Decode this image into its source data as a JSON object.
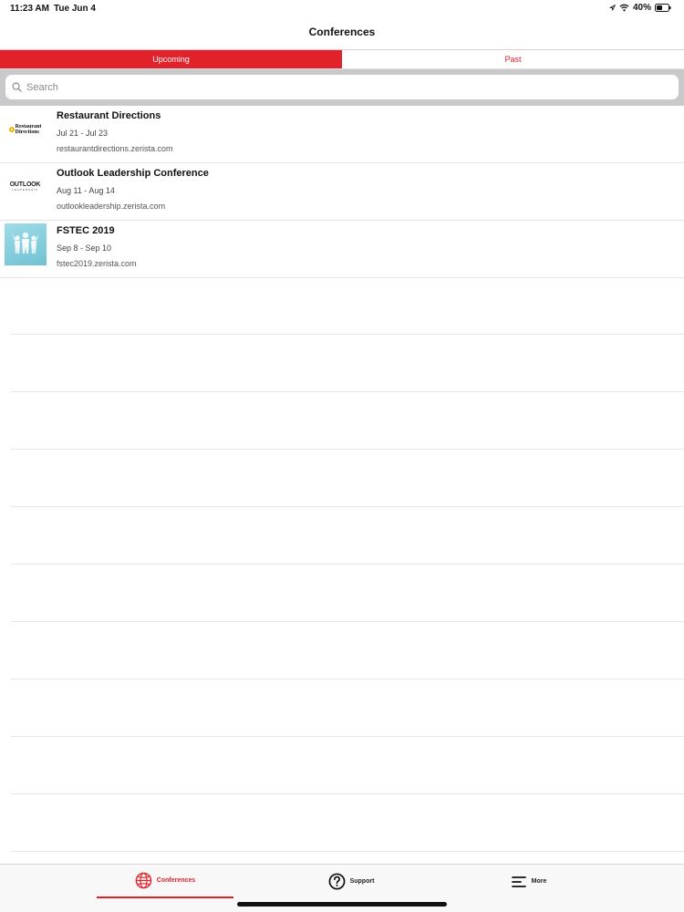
{
  "status_bar": {
    "time": "11:23 AM",
    "date": "Tue Jun 4",
    "battery": "40%"
  },
  "header": {
    "title": "Conferences"
  },
  "segments": {
    "upcoming": "Upcoming",
    "past": "Past",
    "selected": "upcoming"
  },
  "search": {
    "placeholder": "Search",
    "value": ""
  },
  "conferences": [
    {
      "title": "Restaurant Directions",
      "dates": "Jul 21 - Jul 23",
      "url": "restaurantdirections.zerista.com",
      "logo_text": [
        "Restaurant",
        "Directions"
      ]
    },
    {
      "title": "Outlook Leadership Conference",
      "dates": "Aug 11 - Aug 14",
      "url": "outlookleadership.zerista.com",
      "logo_text": [
        "OUTLOOK",
        "LEADERSHIP"
      ]
    },
    {
      "title": "FSTEC 2019",
      "dates": "Sep 8 - Sep 10",
      "url": "fstec2019.zerista.com"
    }
  ],
  "tab_bar": {
    "conferences": "Conferences",
    "support": "Support",
    "more": "More",
    "selected": "conferences"
  },
  "colors": {
    "accent": "#e2222a",
    "search_bg": "#c9c9cc"
  },
  "icons": {
    "wifi": "wifi-icon",
    "battery": "battery-icon",
    "search": "search-icon",
    "conferences_tab": "globe-icon",
    "support_tab": "question-circle-icon",
    "more_tab": "menu-lines-icon"
  }
}
